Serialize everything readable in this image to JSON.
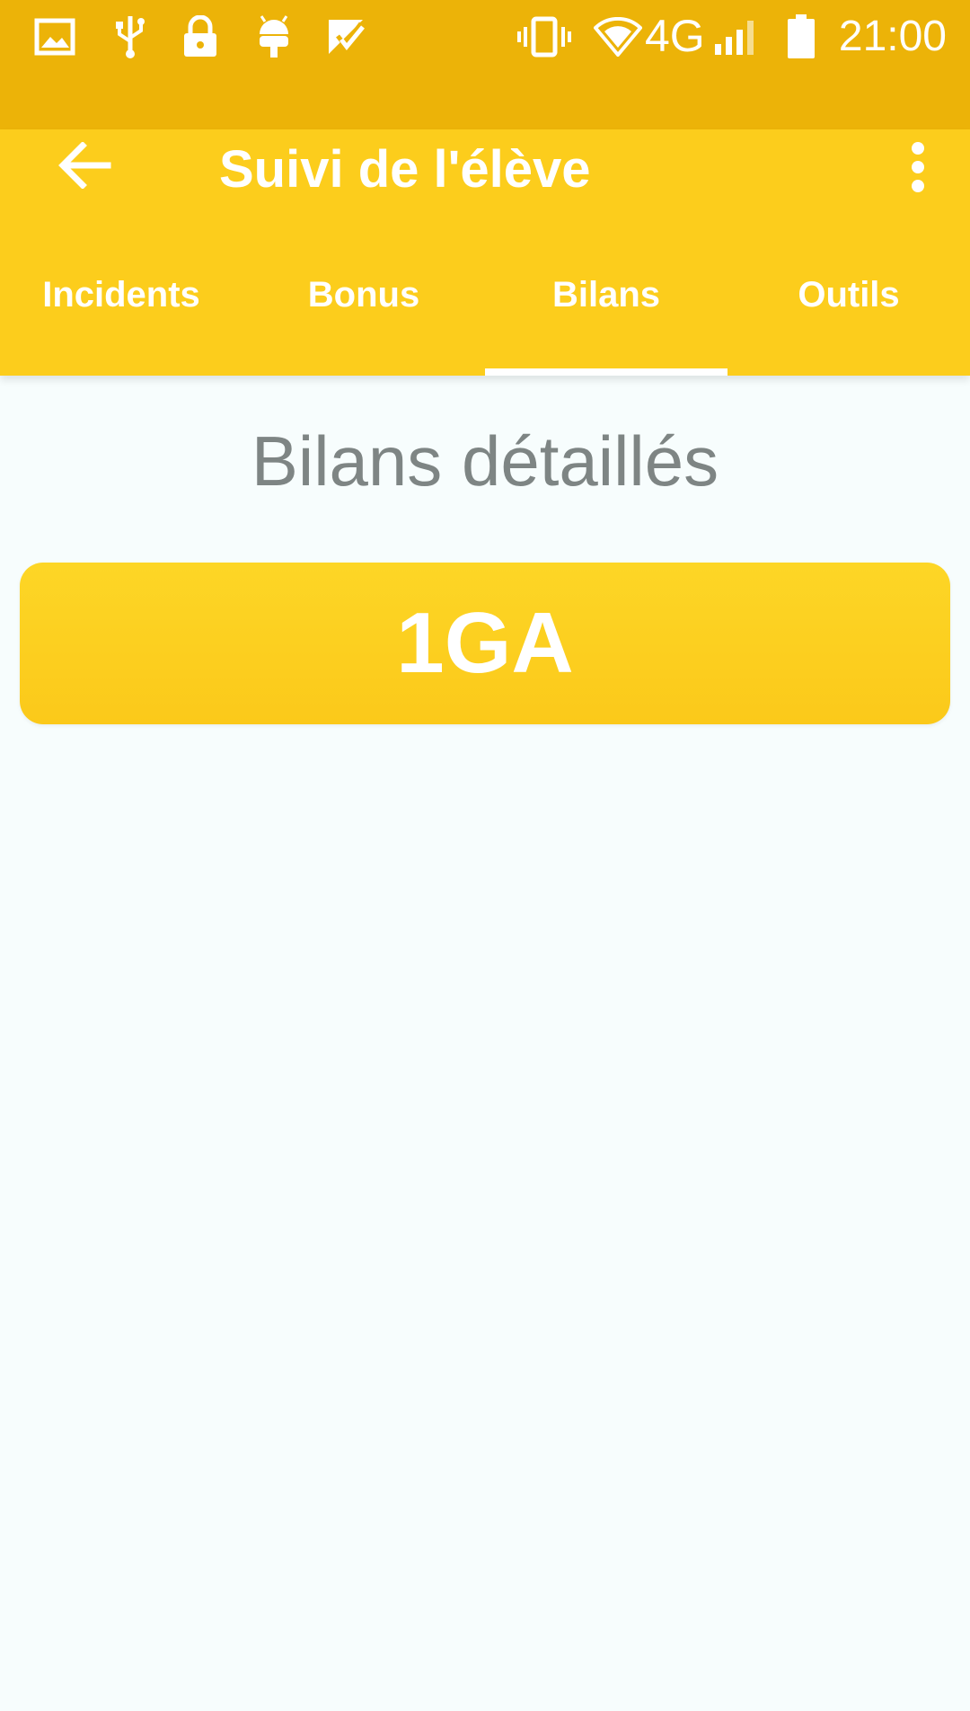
{
  "status_bar": {
    "left_icons": [
      "image-icon",
      "usb-icon",
      "lock-icon",
      "android-debug-icon",
      "app-notification-icon"
    ],
    "right_icons": [
      "vibrate-icon",
      "wifi-icon",
      "signal-icon",
      "battery-icon"
    ],
    "network": "4G",
    "time": "21:00"
  },
  "appbar": {
    "title": "Suivi de l'élève",
    "background_color": "#fccd1c"
  },
  "tabs": [
    {
      "label": "Incidents",
      "selected": false
    },
    {
      "label": "Bonus",
      "selected": false
    },
    {
      "label": "Bilans",
      "selected": true
    },
    {
      "label": "Outils",
      "selected": false
    }
  ],
  "main": {
    "section_title": "Bilans détaillés",
    "class_button_label": "1GA",
    "accent_color": "#fdd626"
  }
}
